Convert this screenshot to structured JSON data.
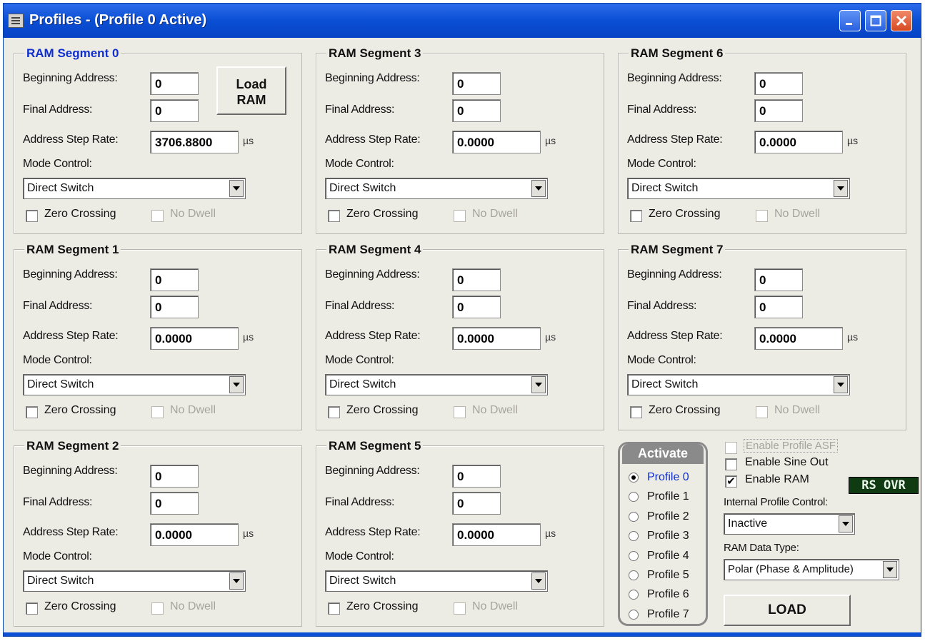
{
  "window": {
    "title": "Profiles - (Profile 0 Active)"
  },
  "labels": {
    "beginning_address": "Beginning Address:",
    "final_address": "Final Address:",
    "address_step_rate": "Address Step Rate:",
    "mode_control": "Mode Control:",
    "unit": "µs",
    "zero_crossing": "Zero Crossing",
    "no_dwell": "No Dwell"
  },
  "segments": [
    {
      "title": "RAM Segment 0",
      "beginning_address": "0",
      "final_address": "0",
      "step_rate": "3706.8800",
      "mode": "Direct Switch",
      "zero_crossing": false,
      "no_dwell": false
    },
    {
      "title": "RAM Segment 1",
      "beginning_address": "0",
      "final_address": "0",
      "step_rate": "0.0000",
      "mode": "Direct Switch",
      "zero_crossing": false,
      "no_dwell": false
    },
    {
      "title": "RAM Segment 2",
      "beginning_address": "0",
      "final_address": "0",
      "step_rate": "0.0000",
      "mode": "Direct Switch",
      "zero_crossing": false,
      "no_dwell": false
    },
    {
      "title": "RAM Segment 3",
      "beginning_address": "0",
      "final_address": "0",
      "step_rate": "0.0000",
      "mode": "Direct Switch",
      "zero_crossing": false,
      "no_dwell": false
    },
    {
      "title": "RAM Segment 4",
      "beginning_address": "0",
      "final_address": "0",
      "step_rate": "0.0000",
      "mode": "Direct Switch",
      "zero_crossing": false,
      "no_dwell": false
    },
    {
      "title": "RAM Segment 5",
      "beginning_address": "0",
      "final_address": "0",
      "step_rate": "0.0000",
      "mode": "Direct Switch",
      "zero_crossing": false,
      "no_dwell": false
    },
    {
      "title": "RAM Segment 6",
      "beginning_address": "0",
      "final_address": "0",
      "step_rate": "0.0000",
      "mode": "Direct Switch",
      "zero_crossing": false,
      "no_dwell": false
    },
    {
      "title": "RAM Segment 7",
      "beginning_address": "0",
      "final_address": "0",
      "step_rate": "0.0000",
      "mode": "Direct Switch",
      "zero_crossing": false,
      "no_dwell": false
    }
  ],
  "load_ram_button": {
    "line1": "Load",
    "line2": "RAM"
  },
  "activate": {
    "title": "Activate",
    "profiles": [
      "Profile 0",
      "Profile 1",
      "Profile 2",
      "Profile 3",
      "Profile 4",
      "Profile 5",
      "Profile 6",
      "Profile 7"
    ],
    "selected_index": 0
  },
  "options": {
    "enable_profile_asf": {
      "label": "Enable Profile ASF",
      "checked": false,
      "disabled": true
    },
    "enable_sine_out": {
      "label": "Enable Sine Out",
      "checked": false
    },
    "enable_ram": {
      "label": "Enable RAM",
      "checked": true
    },
    "status_indicator": "RS OVR",
    "internal_profile_control": {
      "label": "Internal Profile Control:",
      "value": "Inactive"
    },
    "ram_data_type": {
      "label": "RAM Data Type:",
      "value": "Polar (Phase & Amplitude)"
    },
    "load_button": "LOAD"
  },
  "colors": {
    "title_bar": "#0a4fd4",
    "active_text": "#0f2fd1",
    "indicator_bg": "#0f3a12",
    "face": "#ecebe4"
  }
}
